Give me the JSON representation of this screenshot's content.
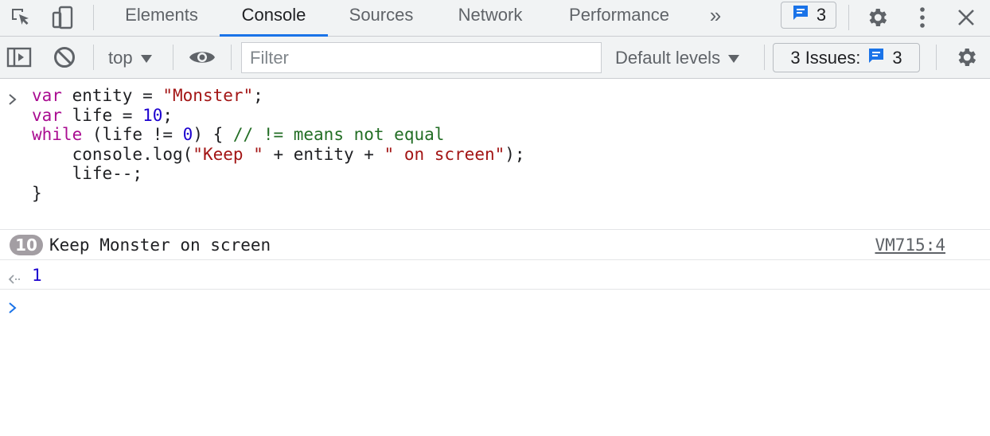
{
  "tabbar": {
    "tabs": [
      {
        "label": "Elements",
        "active": false
      },
      {
        "label": "Console",
        "active": true
      },
      {
        "label": "Sources",
        "active": false
      },
      {
        "label": "Network",
        "active": false
      },
      {
        "label": "Performance",
        "active": false
      }
    ],
    "more_tabs_glyph": "»",
    "message_count": "3"
  },
  "toolbar": {
    "context_label": "top",
    "filter_placeholder": "Filter",
    "filter_value": "",
    "levels_label": "Default levels",
    "issues_label": "3 Issues:",
    "issues_count": "3"
  },
  "console": {
    "input_code": [
      [
        {
          "t": "var",
          "c": "kw"
        },
        {
          "t": " entity = ",
          "c": ""
        },
        {
          "t": "\"Monster\"",
          "c": "str"
        },
        {
          "t": ";",
          "c": ""
        }
      ],
      [
        {
          "t": "var",
          "c": "kw"
        },
        {
          "t": " life = ",
          "c": ""
        },
        {
          "t": "10",
          "c": "num"
        },
        {
          "t": ";",
          "c": ""
        }
      ],
      [
        {
          "t": "while",
          "c": "kw"
        },
        {
          "t": " (life != ",
          "c": ""
        },
        {
          "t": "0",
          "c": "num"
        },
        {
          "t": ") { ",
          "c": ""
        },
        {
          "t": "// != means not equal",
          "c": "cmt"
        }
      ],
      [
        {
          "t": "    console.log(",
          "c": ""
        },
        {
          "t": "\"Keep \"",
          "c": "str"
        },
        {
          "t": " + entity + ",
          "c": ""
        },
        {
          "t": "\" on screen\"",
          "c": "str"
        },
        {
          "t": ");",
          "c": ""
        }
      ],
      [
        {
          "t": "    life--;",
          "c": ""
        }
      ],
      [
        {
          "t": "}",
          "c": ""
        }
      ]
    ],
    "log_repeat_count": "10",
    "log_message": "Keep Monster on screen",
    "log_source": "VM715:4",
    "result_value": "1"
  },
  "colors": {
    "accent": "#1a73e8",
    "keyword": "#aa0d91",
    "string": "#a31515",
    "number": "#1c00cf",
    "comment": "#236e25"
  }
}
